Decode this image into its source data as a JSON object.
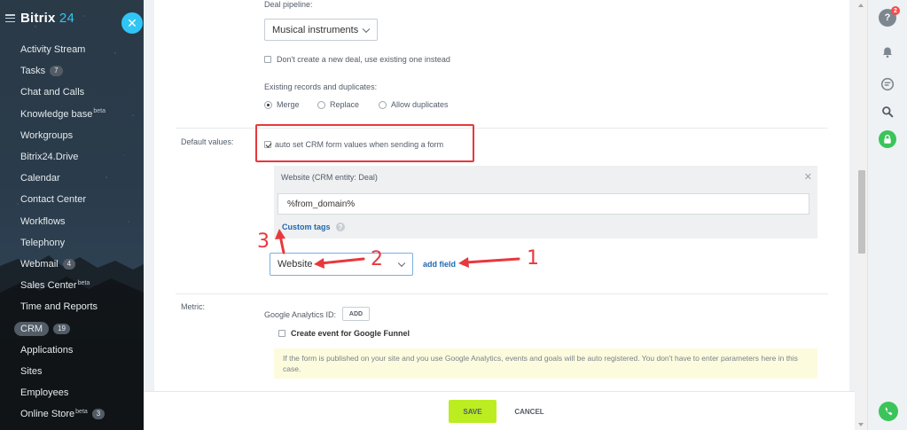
{
  "brand": {
    "name": "Bitrix",
    "number": "24"
  },
  "collapse_icon": "close-icon",
  "sidebar": {
    "items": [
      {
        "label": "Activity Stream",
        "count": "",
        "sup": ""
      },
      {
        "label": "Tasks",
        "count": "7",
        "sup": ""
      },
      {
        "label": "Chat and Calls",
        "count": "",
        "sup": ""
      },
      {
        "label": "Knowledge base",
        "count": "",
        "sup": "beta"
      },
      {
        "label": "Workgroups",
        "count": "",
        "sup": ""
      },
      {
        "label": "Bitrix24.Drive",
        "count": "",
        "sup": ""
      },
      {
        "label": "Calendar",
        "count": "",
        "sup": ""
      },
      {
        "label": "Contact Center",
        "count": "",
        "sup": ""
      },
      {
        "label": "Workflows",
        "count": "",
        "sup": ""
      },
      {
        "label": "Telephony",
        "count": "",
        "sup": ""
      },
      {
        "label": "Webmail",
        "count": "4",
        "sup": ""
      },
      {
        "label": "Sales Center",
        "count": "",
        "sup": "beta"
      },
      {
        "label": "Time and Reports",
        "count": "",
        "sup": ""
      },
      {
        "label": "CRM",
        "count": "19",
        "sup": ""
      },
      {
        "label": "Applications",
        "count": "",
        "sup": ""
      },
      {
        "label": "Sites",
        "count": "",
        "sup": ""
      },
      {
        "label": "Employees",
        "count": "",
        "sup": ""
      },
      {
        "label": "Online Store",
        "count": "3",
        "sup": "beta"
      }
    ]
  },
  "form": {
    "deal_pipeline_label": "Deal pipeline:",
    "deal_pipeline_value": "Musical instruments",
    "no_new_deal_label": "Don't create a new deal, use existing one instead",
    "existing_records_label": "Existing records and duplicates:",
    "duplicates_options": [
      "Merge",
      "Replace",
      "Allow duplicates"
    ],
    "default_values_label": "Default values:",
    "auto_set_label": "auto set CRM form values when sending a form",
    "entity_title": "Website (CRM entity: Deal)",
    "entity_value": "%from_domain%",
    "custom_tags_label": "Custom tags",
    "field_select_value": "Website",
    "add_field_label": "add field",
    "metric_label": "Metric:",
    "ga_id_label": "Google Analytics ID:",
    "ga_add_label": "ADD",
    "ga_funnel_label": "Create event for Google Funnel",
    "ga_info": "If the form is published on your site and you use Google Analytics, events and goals will be auto registered. You don't have to enter parameters here in this case."
  },
  "footer": {
    "save_label": "SAVE",
    "cancel_label": "CANCEL"
  },
  "annotations": {
    "step1": "1",
    "step2": "2",
    "step3": "3"
  },
  "right_panel": {
    "help_badge": "2"
  },
  "colors": {
    "accent": "#2fc6f6",
    "save": "#bbed21",
    "annotation": "#e8383d",
    "link": "#2067b0"
  }
}
